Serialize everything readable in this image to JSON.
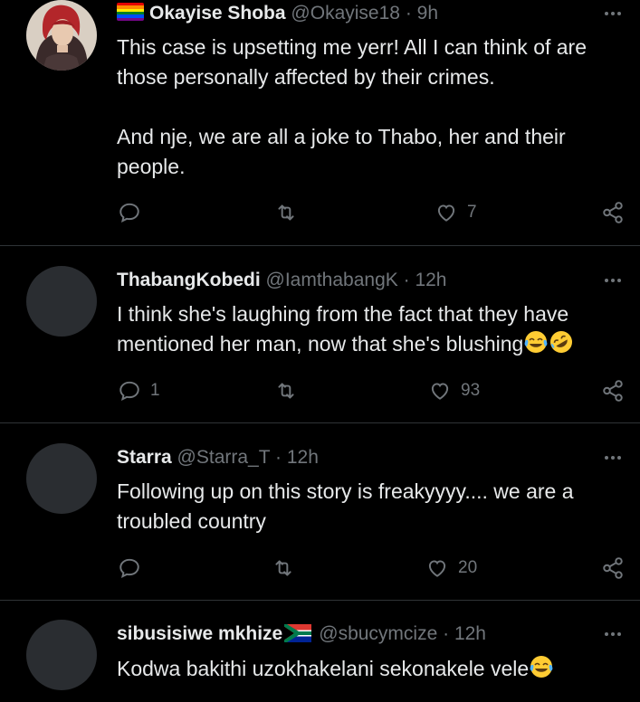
{
  "tweets": [
    {
      "name": "Okayise Shoba",
      "handle": "@Okayise18",
      "separator": "·",
      "time": "9h",
      "text": "This case is upsetting me yerr! All I can think of are those personally affected by their crimes.\n\nAnd nje, we are all a joke to Thabo, her and their people.",
      "replies": "",
      "retweets": "",
      "likes": "7",
      "name_flag": "rainbow-flag"
    },
    {
      "name": "ThabangKobedi",
      "handle": "@IamthabangK",
      "separator": "·",
      "time": "12h",
      "text": "I think she's laughing from the fact that they have mentioned her man, now that she's blushing",
      "replies": "1",
      "retweets": "",
      "likes": "93",
      "text_emojis": [
        "face-with-tears-of-joy",
        "rolling-on-floor-laughing"
      ]
    },
    {
      "name": "Starra",
      "handle": "@Starra_T",
      "separator": "·",
      "time": "12h",
      "text": "Following up on this story is freakyyyy.... we are a troubled country",
      "replies": "",
      "retweets": "",
      "likes": "20"
    },
    {
      "name": "sibusisiwe mkhize",
      "handle": "@sbucymcize",
      "separator": "·",
      "time": "12h",
      "text": "Kodwa bakithi uzokhakelani sekonakele vele",
      "text_emojis": [
        "face-with-tears-of-joy"
      ],
      "name_flag": "south-africa-flag"
    }
  ],
  "colors": {
    "background": "#000000",
    "text": "#e7e9ea",
    "muted": "#71767b",
    "divider": "#2f3336",
    "avatar_placeholder": "#2a2d31"
  }
}
